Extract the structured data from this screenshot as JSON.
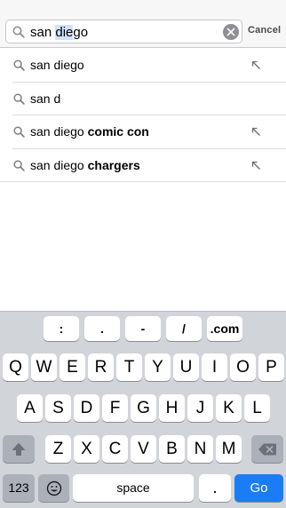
{
  "search": {
    "query_prefix": "san ",
    "query_selected": "die",
    "query_suffix": "go",
    "cancel_label": "Cancel"
  },
  "suggestions": [
    {
      "normal": "san diego",
      "bold": "",
      "fill_arrow": true
    },
    {
      "normal": "san d",
      "bold": "",
      "fill_arrow": false
    },
    {
      "normal": "san diego",
      "bold": " comic con",
      "fill_arrow": true
    },
    {
      "normal": "san diego",
      "bold": " chargers",
      "fill_arrow": true
    }
  ],
  "keyboard": {
    "shortcut_keys": [
      ":",
      ".",
      "-",
      "/",
      ".com"
    ],
    "row1": [
      "Q",
      "W",
      "E",
      "R",
      "T",
      "Y",
      "U",
      "I",
      "O",
      "P"
    ],
    "row2": [
      "A",
      "S",
      "D",
      "F",
      "G",
      "H",
      "J",
      "K",
      "L"
    ],
    "row3": [
      "Z",
      "X",
      "C",
      "V",
      "B",
      "N",
      "M"
    ],
    "numbers_key": "123",
    "space_key": "space",
    "dot_key": ".",
    "go_key": "Go"
  },
  "colors": {
    "go_key": "#1a7cf6",
    "selection": "#cfe2fb"
  }
}
